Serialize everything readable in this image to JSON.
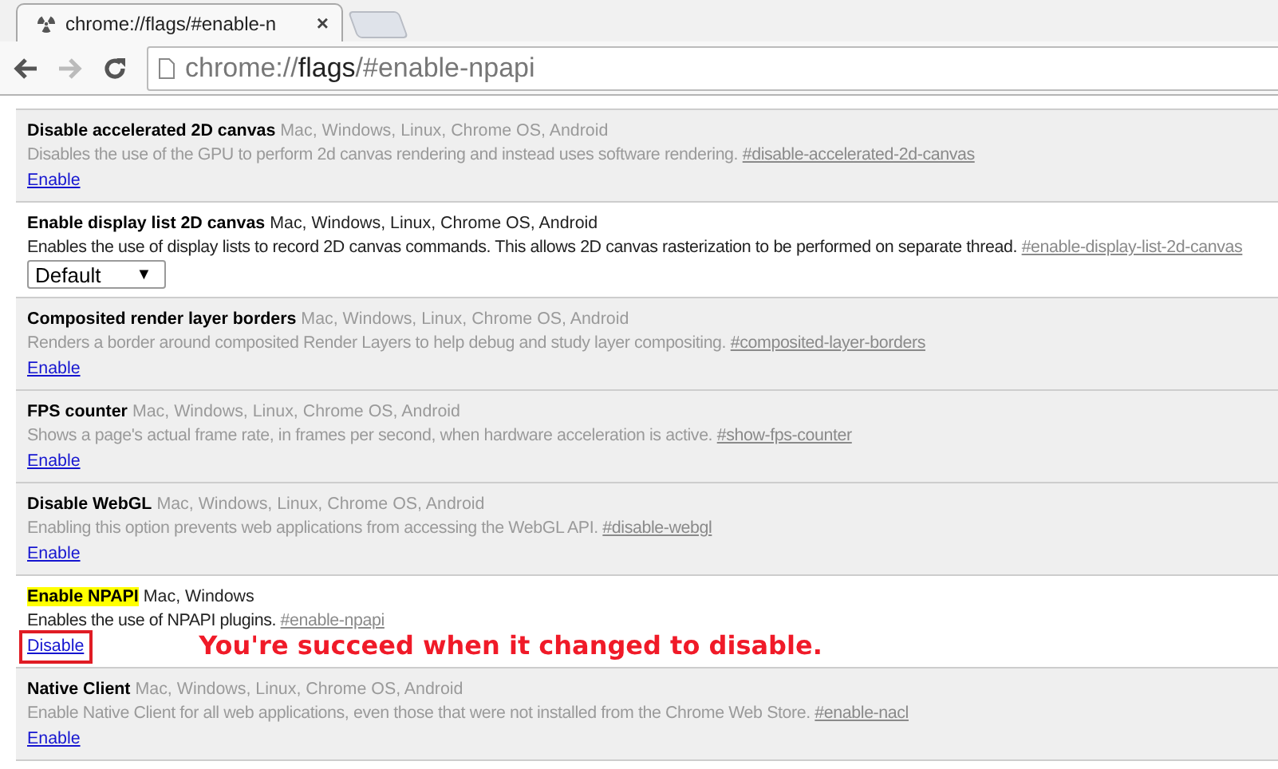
{
  "tab": {
    "title": "chrome://flags/#enable-n",
    "close": "×",
    "selected": true
  },
  "toolbar": {
    "url_host": "chrome://",
    "url_path": "flags",
    "url_rest": "/#enable-npapi"
  },
  "flags": [
    {
      "kind": "link",
      "enabled": false,
      "highlighted": false,
      "title": "Disable accelerated 2D canvas",
      "platforms": "Mac, Windows, Linux, Chrome OS, Android",
      "description": "Disables the use of the GPU to perform 2d canvas rendering and instead uses software rendering.",
      "anchor": "#disable-accelerated-2d-canvas",
      "action": "Enable",
      "boxed": false
    },
    {
      "kind": "select",
      "enabled": true,
      "highlighted": false,
      "title": "Enable display list 2D canvas",
      "platforms": "Mac, Windows, Linux, Chrome OS, Android",
      "description": "Enables the use of display lists to record 2D canvas commands. This allows 2D canvas rasterization to be performed on separate thread.",
      "anchor": "#enable-display-list-2d-canvas",
      "value": "Default",
      "arrow": "▼",
      "boxed": false
    },
    {
      "kind": "link",
      "enabled": false,
      "highlighted": false,
      "title": "Composited render layer borders",
      "platforms": "Mac, Windows, Linux, Chrome OS, Android",
      "description": "Renders a border around composited Render Layers to help debug and study layer compositing.",
      "anchor": "#composited-layer-borders",
      "action": "Enable",
      "boxed": false
    },
    {
      "kind": "link",
      "enabled": false,
      "highlighted": false,
      "title": "FPS counter",
      "platforms": "Mac, Windows, Linux, Chrome OS, Android",
      "description": "Shows a page's actual frame rate, in frames per second, when hardware acceleration is active.",
      "anchor": "#show-fps-counter",
      "action": "Enable",
      "boxed": false
    },
    {
      "kind": "link",
      "enabled": false,
      "highlighted": false,
      "title": "Disable WebGL",
      "platforms": "Mac, Windows, Linux, Chrome OS, Android",
      "description": "Enabling this option prevents web applications from accessing the WebGL API.",
      "anchor": "#disable-webgl",
      "action": "Enable",
      "boxed": false
    },
    {
      "kind": "link",
      "enabled": true,
      "highlighted": true,
      "title": "Enable NPAPI",
      "platforms": "Mac, Windows",
      "description": "Enables the use of NPAPI plugins.",
      "anchor": "#enable-npapi",
      "action": "Disable",
      "boxed": true,
      "note": "You're succeed when it changed to disable."
    },
    {
      "kind": "link",
      "enabled": false,
      "highlighted": false,
      "title": "Native Client",
      "platforms": "Mac, Windows, Linux, Chrome OS, Android",
      "description": "Enable Native Client for all web applications, even those that were not installed from the Chrome Web Store.",
      "anchor": "#enable-nacl",
      "action": "Enable",
      "boxed": false
    }
  ]
}
